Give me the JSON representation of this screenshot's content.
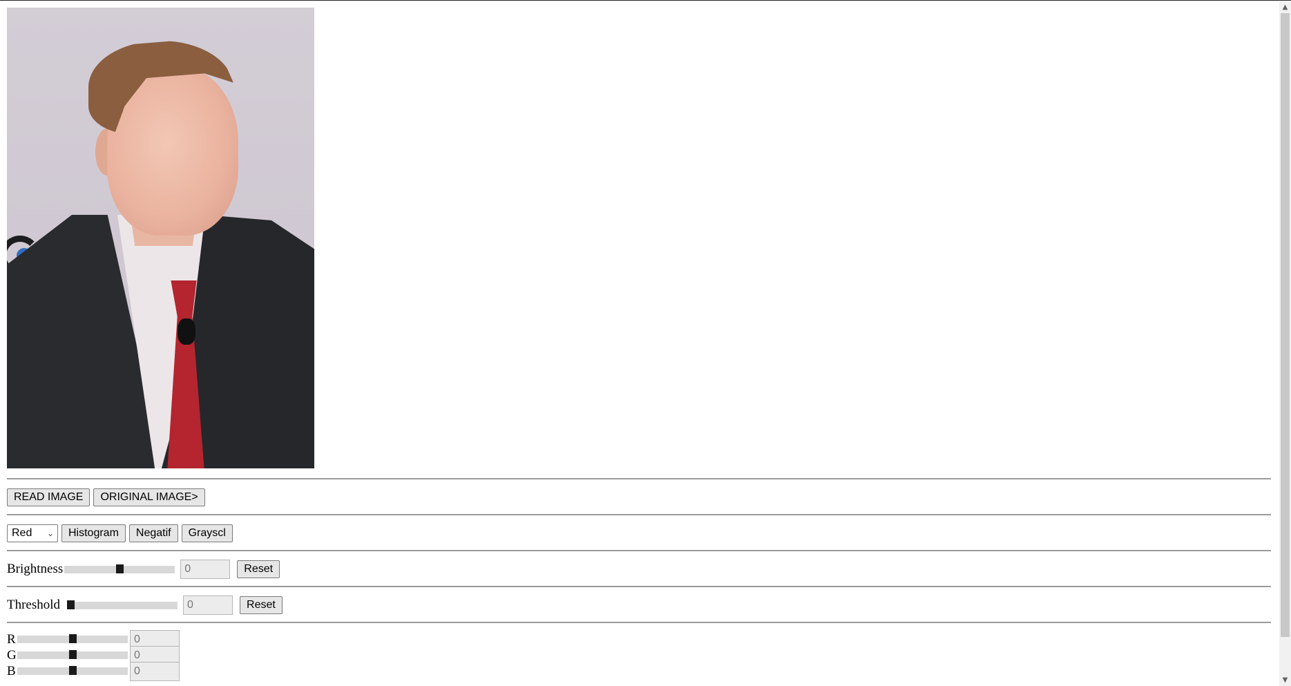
{
  "photo": {
    "icon": "portrait-photo"
  },
  "toolbar1": {
    "read_label": "READ IMAGE",
    "original_label": "ORIGINAL IMAGE>"
  },
  "toolbar2": {
    "channel_select": {
      "value": "Red"
    },
    "histogram_label": "Histogram",
    "negatif_label": "Negatif",
    "grayscl_label": "Grayscl"
  },
  "brightness": {
    "label": "Brightness",
    "value": "0",
    "slider_level": 0.5,
    "reset_label": "Reset"
  },
  "threshold": {
    "label": "Threshold",
    "value": "0",
    "slider_level": 0.0,
    "reset_label": "Reset"
  },
  "rgb": [
    {
      "label": "R",
      "value": "0",
      "slider_level": 0.5
    },
    {
      "label": "G",
      "value": "0",
      "slider_level": 0.5
    },
    {
      "label": "B",
      "value": "0",
      "slider_level": 0.5
    }
  ]
}
